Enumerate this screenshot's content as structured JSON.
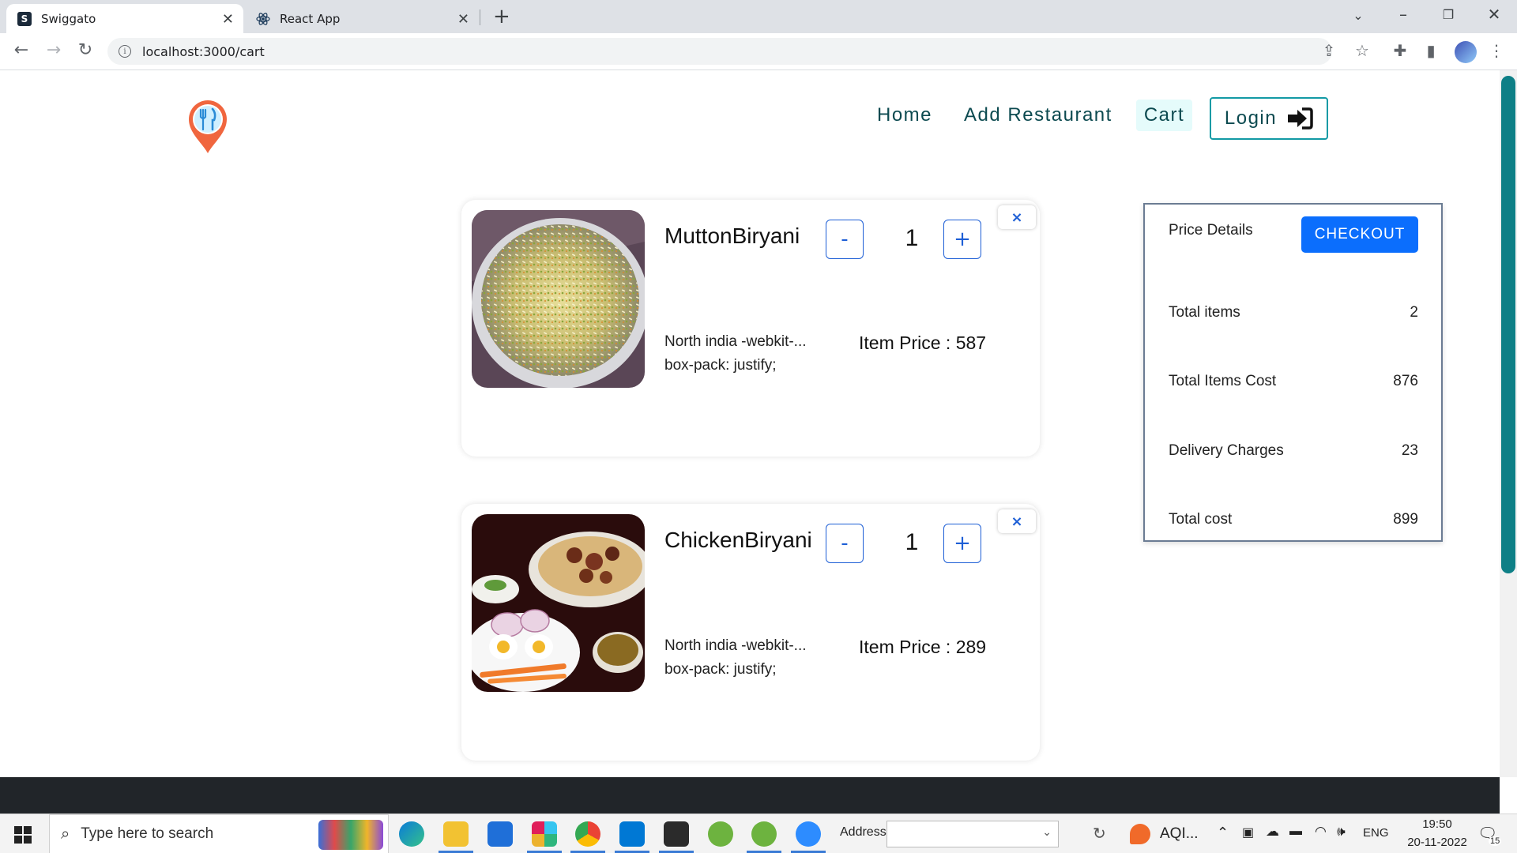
{
  "browser": {
    "tabs": [
      {
        "title": "Swiggato",
        "favicon": "S",
        "active": true
      },
      {
        "title": "React App",
        "favicon": "react-icon",
        "active": false
      }
    ],
    "url": "localhost:3000/cart"
  },
  "nav": {
    "links": [
      "Home",
      "Add Restaurant",
      "Cart"
    ],
    "active": "Cart",
    "login_label": "Login"
  },
  "cart": {
    "items": [
      {
        "name": "MuttonBiryani",
        "quantity": "1",
        "minus_label": "-",
        "plus_label": "+",
        "remove_label": "×",
        "description_line1": "North india -webkit-...",
        "description_line2": "box-pack: justify;",
        "price_text": "Item Price : 587"
      },
      {
        "name": "ChickenBiryani",
        "quantity": "1",
        "minus_label": "-",
        "plus_label": "+",
        "remove_label": "×",
        "description_line1": "North india -webkit-...",
        "description_line2": "box-pack: justify;",
        "price_text": "Item Price : 289"
      }
    ]
  },
  "price_details": {
    "title": "Price Details",
    "checkout_label": "CHECKOUT",
    "rows": [
      {
        "label": "Total items",
        "value": "2"
      },
      {
        "label": "Total Items Cost",
        "value": "876"
      },
      {
        "label": "Delivery Charges",
        "value": "23"
      },
      {
        "label": "Total cost",
        "value": "899"
      }
    ]
  },
  "taskbar": {
    "search_placeholder": "Type here to search",
    "address_label": "Address",
    "weather_text": "AQI...",
    "language": "ENG",
    "time": "19:50",
    "date": "20-11-2022",
    "notification_count": "15"
  },
  "colors": {
    "accent": "#0b6efd",
    "nav_text": "#0c4a50",
    "login_border": "#139aa5",
    "cart_highlight": "#e5fbfb",
    "footer": "#212529"
  }
}
